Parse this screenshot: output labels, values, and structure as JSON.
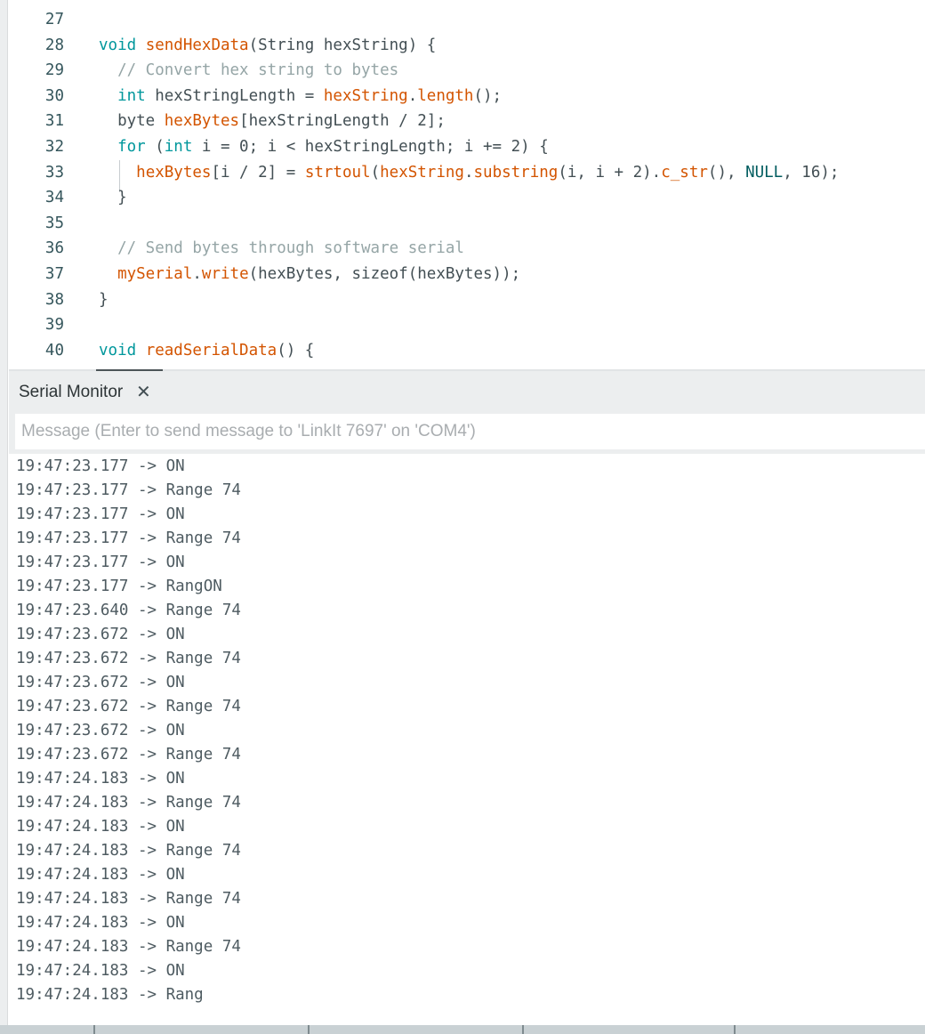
{
  "editor": {
    "lines": [
      {
        "num": "27",
        "tokens": []
      },
      {
        "num": "28",
        "tokens": [
          [
            "kw",
            "void "
          ],
          [
            "fn",
            "sendHexData"
          ],
          [
            "p",
            "(String hexString) {"
          ]
        ]
      },
      {
        "num": "29",
        "tokens": [
          [
            "p",
            "  "
          ],
          [
            "cm",
            "// Convert hex string to bytes"
          ]
        ]
      },
      {
        "num": "30",
        "tokens": [
          [
            "p",
            "  "
          ],
          [
            "kw",
            "int"
          ],
          [
            "p",
            " hexStringLength = "
          ],
          [
            "fn",
            "hexString"
          ],
          [
            "p",
            "."
          ],
          [
            "fn",
            "length"
          ],
          [
            "p",
            "();"
          ]
        ]
      },
      {
        "num": "31",
        "tokens": [
          [
            "p",
            "  byte "
          ],
          [
            "fn",
            "hexBytes"
          ],
          [
            "p",
            "[hexStringLength / 2];"
          ]
        ]
      },
      {
        "num": "32",
        "tokens": [
          [
            "p",
            "  "
          ],
          [
            "kw",
            "for"
          ],
          [
            "p",
            " ("
          ],
          [
            "kw",
            "int"
          ],
          [
            "p",
            " i = 0; i < hexStringLength; i += 2) {"
          ]
        ]
      },
      {
        "num": "33",
        "tokens": [
          [
            "p",
            "    "
          ],
          [
            "fn",
            "hexBytes"
          ],
          [
            "p",
            "[i / 2] = "
          ],
          [
            "fn",
            "strtoul"
          ],
          [
            "p",
            "("
          ],
          [
            "fn",
            "hexString"
          ],
          [
            "p",
            "."
          ],
          [
            "fn",
            "substring"
          ],
          [
            "p",
            "(i, i + 2)."
          ],
          [
            "fn",
            "c_str"
          ],
          [
            "p",
            "(), "
          ],
          [
            "nm",
            "NULL"
          ],
          [
            "p",
            ", 16);"
          ]
        ]
      },
      {
        "num": "34",
        "tokens": [
          [
            "p",
            "  }"
          ]
        ]
      },
      {
        "num": "35",
        "tokens": []
      },
      {
        "num": "36",
        "tokens": [
          [
            "p",
            "  "
          ],
          [
            "cm",
            "// Send bytes through software serial"
          ]
        ]
      },
      {
        "num": "37",
        "tokens": [
          [
            "p",
            "  "
          ],
          [
            "fn",
            "mySerial"
          ],
          [
            "p",
            "."
          ],
          [
            "fn",
            "write"
          ],
          [
            "p",
            "(hexBytes, sizeof(hexBytes));"
          ]
        ]
      },
      {
        "num": "38",
        "tokens": [
          [
            "p",
            "}"
          ]
        ]
      },
      {
        "num": "39",
        "tokens": []
      },
      {
        "num": "40",
        "tokens": [
          [
            "kw",
            "void "
          ],
          [
            "fn",
            "readSerialData"
          ],
          [
            "p",
            "() {"
          ]
        ]
      }
    ]
  },
  "serial_monitor": {
    "title": "Serial Monitor",
    "close_icon": "close-icon",
    "close_glyph": "✕",
    "message_placeholder": "Message (Enter to send message to 'LinkIt 7697' on 'COM4')",
    "output_lines": [
      "19:47:23.177 -> ON",
      "19:47:23.177 -> Range 74",
      "19:47:23.177 -> ON",
      "19:47:23.177 -> Range 74",
      "19:47:23.177 -> ON",
      "19:47:23.177 -> RangON",
      "19:47:23.640 -> Range 74",
      "19:47:23.672 -> ON",
      "19:47:23.672 -> Range 74",
      "19:47:23.672 -> ON",
      "19:47:23.672 -> Range 74",
      "19:47:23.672 -> ON",
      "19:47:23.672 -> Range 74",
      "19:47:24.183 -> ON",
      "19:47:24.183 -> Range 74",
      "19:47:24.183 -> ON",
      "19:47:24.183 -> Range 74",
      "19:47:24.183 -> ON",
      "19:47:24.183 -> Range 74",
      "19:47:24.183 -> ON",
      "19:47:24.183 -> Range 74",
      "19:47:24.183 -> ON",
      "19:47:24.183 -> Rang"
    ]
  },
  "colors": {
    "keyword": "#00979c",
    "function": "#d35400",
    "comment": "#95a5a6",
    "constant": "#005c5f",
    "text": "#434f54",
    "line_number": "#35565c",
    "panel_bg": "#eceeef"
  }
}
